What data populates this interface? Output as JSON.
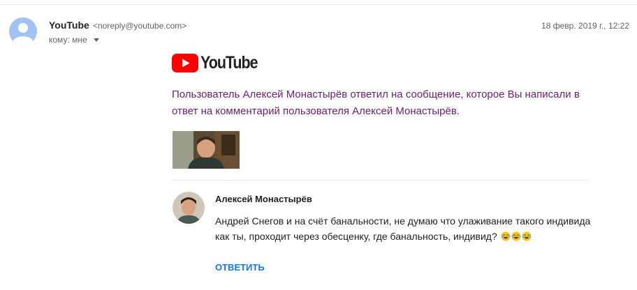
{
  "header": {
    "sender_name": "YouTube",
    "sender_email": "<noreply@youtube.com>",
    "recipient": "кому: мне",
    "date": "18 февр. 2019 г., 12:22"
  },
  "body": {
    "logo_text": "YouTube",
    "notice": "Пользователь Алексей Монастырёв ответил на сообщение, которое Вы написали в ответ на комментарий пользователя Алексей Монастырёв.",
    "comment": {
      "author": "Алексей Монастырёв",
      "text": "Андрей Снегов и на счёт банальности, не думаю что улаживание такого индивида как ты, проходит через обесценку, где банальность, индивид?",
      "reply_label": "ОТВЕТИТЬ"
    }
  },
  "colors": {
    "notice_text": "#6b2173",
    "link": "#1a73e8",
    "youtube_red": "#ff0000",
    "avatar_bg": "#a3c2f4"
  },
  "icons": [
    "default-avatar-icon",
    "youtube-play-icon",
    "dropdown-caret-icon",
    "laughing-emoji-icon"
  ]
}
